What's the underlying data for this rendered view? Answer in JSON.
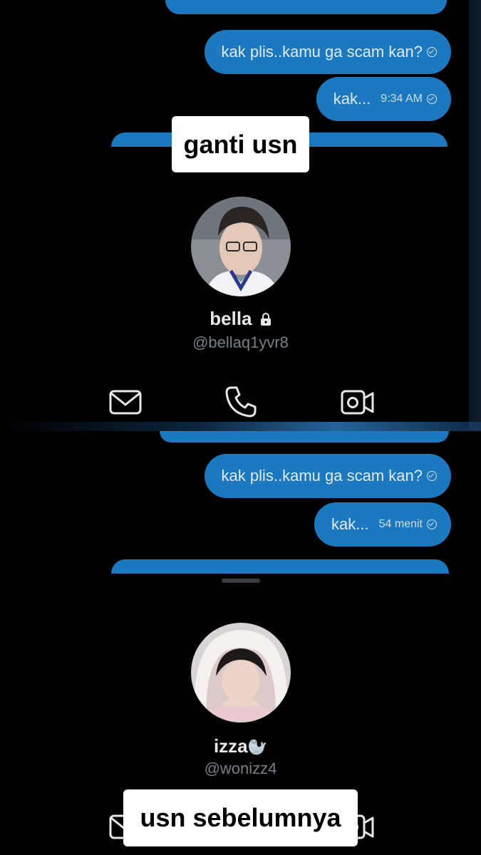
{
  "top_panel": {
    "messages": [
      {
        "text": "kak plis..kamu ga scam kan?",
        "time": ""
      },
      {
        "text": "kak...",
        "time": "9:34 AM"
      }
    ],
    "profile": {
      "display_name": "bella",
      "handle": "@bellaq1yvr8",
      "locked": true
    },
    "actions": [
      "message-icon",
      "phone-icon",
      "video-call-icon"
    ]
  },
  "bottom_panel": {
    "messages": [
      {
        "text": "kak plis..kamu ga scam kan?",
        "time": ""
      },
      {
        "text": "kak...",
        "time": "54 menit"
      }
    ],
    "profile": {
      "display_name": "izza",
      "name_emoji": "🦭",
      "handle": "@wonizz4"
    },
    "actions": [
      "message-icon",
      "video-call-icon"
    ]
  },
  "captions": {
    "top": "ganti usn",
    "bottom": "usn sebelumnya"
  },
  "colors": {
    "bubble": "#1d79bf",
    "background": "#000000",
    "handle_text": "#7a7f86",
    "caption_bg": "#ffffff"
  }
}
